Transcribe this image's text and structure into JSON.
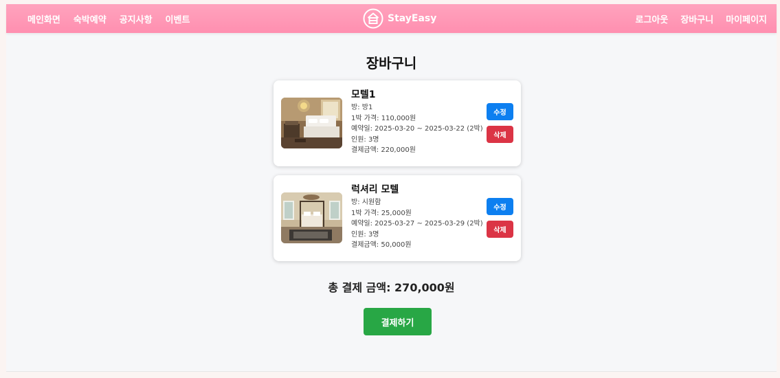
{
  "nav": {
    "left": [
      "메인화면",
      "숙박예약",
      "공지사항",
      "이벤트"
    ],
    "right": [
      "로그아웃",
      "장바구니",
      "마이페이지"
    ],
    "brand": "StayEasy",
    "logo_icon": "hotel-logo-icon"
  },
  "page": {
    "title": "장바구니"
  },
  "cart": {
    "items": [
      {
        "name": "모텔1",
        "room": "방: 방1",
        "price": "1박 가격: 110,000원",
        "dates": "예약일: 2025-03-20 ~ 2025-03-22 (2박)",
        "guests": "인원: 3명",
        "amount": "결제금액: 220,000원",
        "edit_label": "수정",
        "delete_label": "삭제"
      },
      {
        "name": "럭셔리 모텔",
        "room": "방: 시원함",
        "price": "1박 가격: 25,000원",
        "dates": "예약일: 2025-03-27 ~ 2025-03-29 (2박)",
        "guests": "인원: 3명",
        "amount": "결제금액: 50,000원",
        "edit_label": "수정",
        "delete_label": "삭제"
      }
    ],
    "total": "총 결제 금액: 270,000원",
    "pay_label": "결제하기"
  },
  "colors": {
    "nav_gradient_top": "#ffa3bd",
    "nav_gradient_bottom": "#ff8fb0",
    "edit_button": "#0d7ff0",
    "delete_button": "#db3445",
    "pay_button": "#28a745"
  }
}
